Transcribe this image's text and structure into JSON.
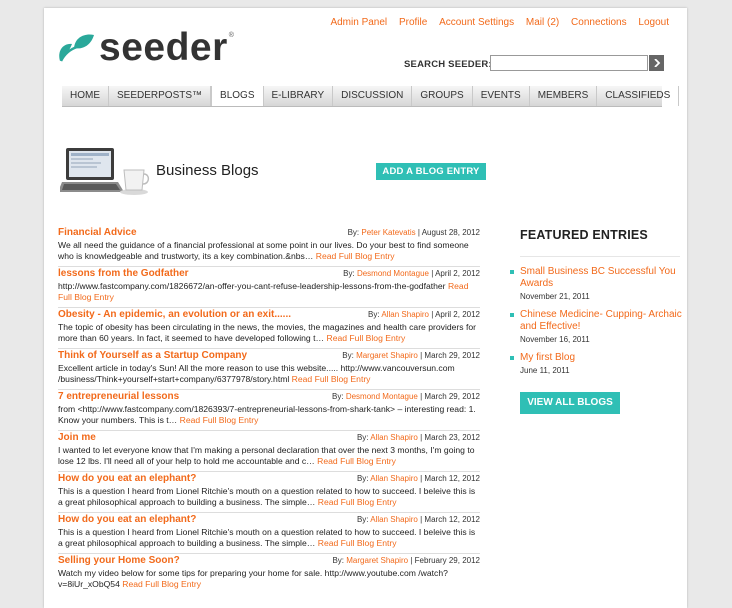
{
  "top_links": [
    "Admin Panel",
    "Profile",
    "Account Settings",
    "Mail (2)",
    "Connections",
    "Logout"
  ],
  "logo": {
    "text": "seeder",
    "reg": "®"
  },
  "search": {
    "label": "SEARCH SEEDER:",
    "value": ""
  },
  "nav": [
    "HOME",
    "SEEDERPOSTS™",
    "BLOGS",
    "E-LIBRARY",
    "DISCUSSION",
    "GROUPS",
    "EVENTS",
    "MEMBERS",
    "CLASSIFIEDS"
  ],
  "page": {
    "title": "Business Blogs",
    "add_button": "ADD A BLOG ENTRY"
  },
  "entries": [
    {
      "title": "Financial Advice",
      "by": "By:",
      "author": "Peter Katevatis",
      "date": "| August 28, 2012",
      "excerpt": "We all need the guidance of a financial professional at some point in our lives.  Do your best to find someone who is knowledgeable and trustworty, its a key combination.&nbs…",
      "read_more": "Read Full Blog Entry"
    },
    {
      "title": "lessons from the Godfather",
      "by": "By:",
      "author": "Desmond Montague",
      "date": "| April 2, 2012",
      "excerpt": "http://www.fastcompany.com/1826672/an-offer-you-cant-refuse-leadership-lessons-from-the-godfather",
      "read_more": "Read Full Blog Entry"
    },
    {
      "title": "Obesity - An epidemic, an evolution or an exit......",
      "by": "By:",
      "author": "Allan Shapiro",
      "date": "| April 2, 2012",
      "excerpt": "The topic of obesity has been circulating in the news, the movies, the magazines and health care providers for more than 60 years. In fact, it seemed to have developed following t…",
      "read_more": "Read Full Blog Entry"
    },
    {
      "title": "Think of Yourself as a Startup Company",
      "by": "By:",
      "author": "Margaret Shapiro",
      "date": "| March 29, 2012",
      "excerpt": "Excellent article in today's Sun! All the more reason to use this website.....   http://www.vancouversun.com /business/Think+yourself+start+company/6377978/story.html",
      "read_more": "Read Full Blog Entry"
    },
    {
      "title": "7 entrepreneurial lessons",
      "by": "By:",
      "author": "Desmond Montague",
      "date": "| March 29, 2012",
      "excerpt": "from  <http://www.fastcompany.com/1826393/7-entrepreneurial-lessons-from-shark-tank>  – interesting read:   1. Know your numbers. This is t…",
      "read_more": "Read Full Blog Entry"
    },
    {
      "title": "Join me",
      "by": "By:",
      "author": "Allan Shapiro",
      "date": "| March 23, 2012",
      "excerpt": "I wanted to let everyone know that I'm making a personal declaration that over the next 3 months, I'm going to lose 12 lbs. I'll need all of your help to hold me accountable and c…",
      "read_more": "Read Full Blog Entry"
    },
    {
      "title": "How do you eat an elephant?",
      "by": "By:",
      "author": "Allan Shapiro",
      "date": "| March 12, 2012",
      "excerpt": "This is a question I heard from Lionel Ritchie's mouth on a question related to how to succeed. I beleive this is a great philosophical approach to building a business. The simple…",
      "read_more": "Read Full Blog Entry"
    },
    {
      "title": "How do you eat an elephant?",
      "by": "By:",
      "author": "Allan Shapiro",
      "date": "| March 12, 2012",
      "excerpt": "This is a question I heard from Lionel Ritchie's mouth on a question related to how to succeed. I beleive this is a great philosophical approach to building a business. The simple…",
      "read_more": "Read Full Blog Entry"
    },
    {
      "title": "Selling your Home Soon?",
      "by": "By:",
      "author": "Margaret Shapiro",
      "date": "| February 29, 2012",
      "excerpt": "Watch my video below for some tips for preparing your home for sale.  http://www.youtube.com /watch?v=8iUr_xObQ54",
      "read_more": "Read Full Blog Entry"
    }
  ],
  "featured": {
    "title": "FEATURED ENTRIES",
    "items": [
      {
        "title": "Small Business BC Successful You Awards",
        "date": "November 21, 2011"
      },
      {
        "title": "Chinese Medicine- Cupping- Archaic and Effective!",
        "date": "November 16, 2011"
      },
      {
        "title": "My first Blog",
        "date": "June 11, 2011"
      }
    ],
    "view_all": "VIEW ALL BLOGS"
  },
  "colors": {
    "accent": "#f26a1b",
    "teal": "#2fbfb5",
    "leaf": "#2aa89a"
  }
}
